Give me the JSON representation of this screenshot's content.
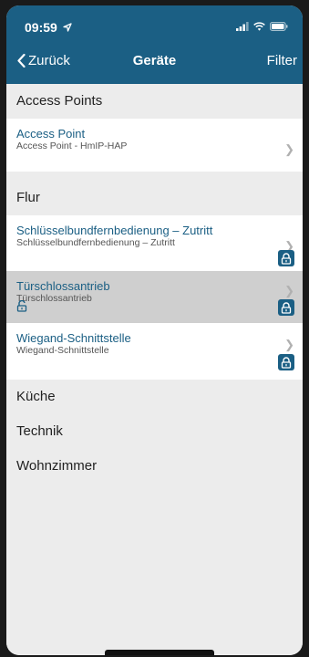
{
  "status": {
    "time": "09:59"
  },
  "nav": {
    "back_label": "Zurück",
    "title": "Geräte",
    "filter_label": "Filter"
  },
  "sections": {
    "access_points": {
      "title": "Access Points",
      "devices": [
        {
          "name": "Access Point",
          "subtitle": "Access Point - HmIP-HAP"
        }
      ]
    },
    "flur": {
      "title": "Flur",
      "devices": [
        {
          "name": "Schlüsselbundfernbedienung – Zutritt",
          "subtitle": "Schlüsselbundfernbedienung – Zutritt"
        },
        {
          "name": "Türschlossantrieb",
          "subtitle": "Türschlossantrieb"
        },
        {
          "name": "Wiegand-Schnittstelle",
          "subtitle": "Wiegand-Schnittstelle"
        }
      ]
    },
    "kueche": {
      "title": "Küche"
    },
    "technik": {
      "title": "Technik"
    },
    "wohnzimmer": {
      "title": "Wohnzimmer"
    }
  },
  "icons": {
    "location_arrow": "location-arrow-icon",
    "signal": "signal-icon",
    "wifi": "wifi-icon",
    "battery": "battery-icon",
    "back": "chevron-left-icon",
    "row_chevron": "chevron-right-icon",
    "lock": "lock-icon",
    "unlock": "unlock-icon"
  },
  "colors": {
    "primary": "#1b5f84",
    "background": "#ececec",
    "selected_row": "#cfcfcf"
  }
}
